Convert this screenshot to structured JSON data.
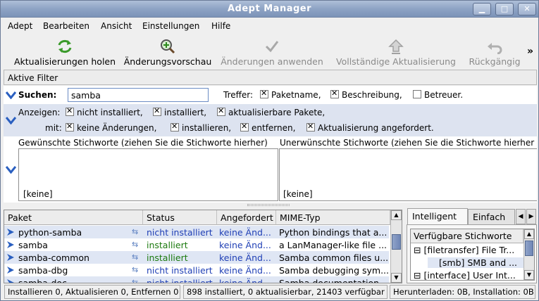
{
  "window": {
    "title": "Adept Manager"
  },
  "menu": [
    "Adept",
    "Bearbeiten",
    "Ansicht",
    "Einstellungen",
    "Hilfe"
  ],
  "toolbar": [
    {
      "label": "Aktualisierungen holen",
      "icon": "refresh-icon",
      "enabled": true
    },
    {
      "label": "Änderungsvorschau",
      "icon": "preview-icon",
      "enabled": true
    },
    {
      "label": "Änderungen anwenden",
      "icon": "checkmark-icon",
      "enabled": false
    },
    {
      "label": "Vollständige Aktualisierung",
      "icon": "upgrade-icon",
      "enabled": false
    },
    {
      "label": "Rückgängig",
      "icon": "undo-icon",
      "enabled": false
    }
  ],
  "toolbar_overflow": "»",
  "filters": {
    "header": "Aktive Filter",
    "search_label": "Suchen:",
    "search_value": "samba",
    "match_label": "Treffer:",
    "match_options": [
      {
        "label": "Paketname,",
        "checked": true
      },
      {
        "label": "Beschreibung,",
        "checked": true
      },
      {
        "label": "Betreuer.",
        "checked": false
      }
    ],
    "show_label": "Anzeigen:",
    "show_options": [
      {
        "label": "nicht installiert,",
        "checked": true
      },
      {
        "label": "installiert,",
        "checked": true
      },
      {
        "label": "aktualisierbare Pakete,",
        "checked": true
      }
    ],
    "with_label": "mit:",
    "with_options": [
      {
        "label": "keine Änderungen,",
        "checked": true
      },
      {
        "label": "installieren,",
        "checked": true
      },
      {
        "label": "entfernen,",
        "checked": true
      },
      {
        "label": "Aktualisierung angefordert.",
        "checked": true
      }
    ],
    "wanted_label": "Gewünschte Stichworte (ziehen Sie die Stichworte hierher)",
    "wanted_value": "[keine]",
    "unwanted_label": "Unerwünschte Stichworte (ziehen Sie die Stichworte hierher",
    "unwanted_value": "[keine]"
  },
  "packages": {
    "columns": [
      "Paket",
      "Status",
      "Angefordert",
      "MIME-Typ"
    ],
    "rows": [
      {
        "name": "python-samba",
        "status": "nicht installiert",
        "requested": "keine Änd...",
        "desc": "Python bindings that a..."
      },
      {
        "name": "samba",
        "status": "installiert",
        "requested": "keine Änd...",
        "desc": "a LanManager-like file ..."
      },
      {
        "name": "samba-common",
        "status": "installiert",
        "requested": "keine Änd...",
        "desc": "Samba common files u..."
      },
      {
        "name": "samba-dbg",
        "status": "nicht installiert",
        "requested": "keine Änd...",
        "desc": "Samba debugging sym..."
      },
      {
        "name": "samba-doc",
        "status": "nicht installiert",
        "requested": "keine Änd...",
        "desc": "Samba documentation"
      }
    ]
  },
  "tags": {
    "tabs": [
      "Intelligent",
      "Einfach"
    ],
    "header": "Verfügbare Stichworte",
    "items": [
      "[filetransfer] File Tr...",
      "[smb] SMB and ...",
      "[interface] User Int..."
    ]
  },
  "statusbar": [
    "Installieren 0, Aktualisieren 0, Entfernen 0",
    "898 installiert, 0 aktualisierbar, 21403 verfügbar",
    "Herunterladen: 0B, Installation: 0B"
  ],
  "colors": {
    "title": "#8ea3c4",
    "selection_row": "#dfe6f4",
    "not_installed": "#1f3fb5",
    "installed": "#1c7a0f"
  }
}
